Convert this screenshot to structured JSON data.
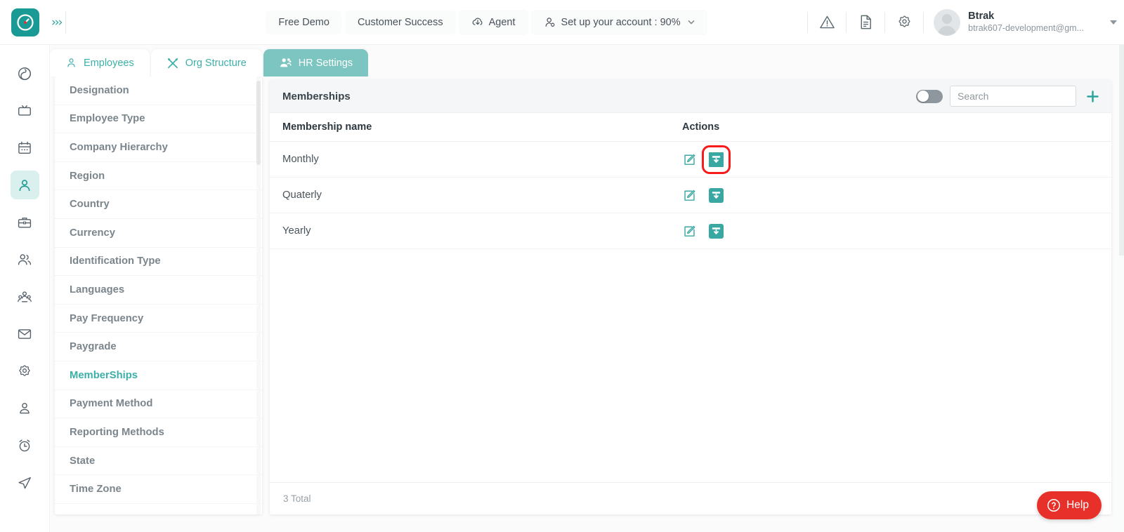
{
  "header": {
    "logo_icon": "clock-logo-icon",
    "expand_icon": "chevrons-right-icon",
    "nav": [
      {
        "label": "Free Demo",
        "icon": null,
        "name": "free-demo"
      },
      {
        "label": "Customer Success",
        "icon": null,
        "name": "customer-success"
      },
      {
        "label": "Agent",
        "icon": "cloud-download-icon",
        "name": "agent"
      },
      {
        "label": "Set up your account : 90%",
        "icon": "user-settings-icon",
        "name": "setup-account",
        "has_caret": true
      }
    ],
    "icons": [
      {
        "name": "warning-icon",
        "glyph": "warning"
      },
      {
        "name": "document-icon",
        "glyph": "document"
      },
      {
        "name": "gear-icon",
        "glyph": "gear"
      }
    ],
    "user": {
      "name": "Btrak",
      "email": "btrak607-development@gm...",
      "avatar_name": "user-avatar"
    }
  },
  "rail": {
    "items": [
      {
        "name": "dashboard-icon",
        "active": false
      },
      {
        "name": "tv-screen-icon",
        "active": false
      },
      {
        "name": "calendar-icon",
        "active": false
      },
      {
        "name": "person-icon",
        "active": true
      },
      {
        "name": "briefcase-icon",
        "active": false
      },
      {
        "name": "people-icon",
        "active": false
      },
      {
        "name": "team-group-icon",
        "active": false
      },
      {
        "name": "mail-icon",
        "active": false
      },
      {
        "name": "settings-gear-icon",
        "active": false
      },
      {
        "name": "user-profile-icon",
        "active": false
      },
      {
        "name": "alarm-clock-icon",
        "active": false
      },
      {
        "name": "send-paper-plane-icon",
        "active": false
      }
    ]
  },
  "tabs": [
    {
      "label": "Employees",
      "icon": "user-outline-icon",
      "active": false
    },
    {
      "label": "Org Structure",
      "icon": "tools-icon",
      "active": false
    },
    {
      "label": "HR Settings",
      "icon": "users-gear-icon",
      "active": true
    }
  ],
  "sidebar": {
    "items": [
      {
        "label": "Designation",
        "active": false
      },
      {
        "label": "Employee Type",
        "active": false
      },
      {
        "label": "Company Hierarchy",
        "active": false
      },
      {
        "label": "Region",
        "active": false
      },
      {
        "label": "Country",
        "active": false
      },
      {
        "label": "Currency",
        "active": false
      },
      {
        "label": "Identification Type",
        "active": false
      },
      {
        "label": "Languages",
        "active": false
      },
      {
        "label": "Pay Frequency",
        "active": false
      },
      {
        "label": "Paygrade",
        "active": false
      },
      {
        "label": "MemberShips",
        "active": true
      },
      {
        "label": "Payment Method",
        "active": false
      },
      {
        "label": "Reporting Methods",
        "active": false
      },
      {
        "label": "State",
        "active": false
      },
      {
        "label": "Time Zone",
        "active": false
      }
    ]
  },
  "main": {
    "title": "Memberships",
    "toggle_state": "off",
    "search_placeholder": "Search",
    "search_value": "",
    "add_button_label": "+",
    "columns": [
      "Membership name",
      "Actions"
    ],
    "rows": [
      {
        "name": "Monthly",
        "edit_icon": "edit-pencil-icon",
        "archive_icon": "archive-down-arrow-icon",
        "highlighted": true
      },
      {
        "name": "Quaterly",
        "edit_icon": "edit-pencil-icon",
        "archive_icon": "archive-down-arrow-icon",
        "highlighted": false
      },
      {
        "name": "Yearly",
        "edit_icon": "edit-pencil-icon",
        "archive_icon": "archive-down-arrow-icon",
        "highlighted": false
      }
    ],
    "footer_total": "3 Total"
  },
  "help": {
    "label": "Help",
    "icon": "question-circle-icon"
  },
  "colors": {
    "brand_teal": "#1a9a94",
    "accent_teal": "#3bb0a8",
    "tab_active": "#7cc5c0",
    "action_teal": "#3aa8a2",
    "highlight_red": "#f71b1b",
    "help_red": "#e8302a",
    "text_dark": "#2d3840",
    "text_muted": "#7b858c"
  }
}
